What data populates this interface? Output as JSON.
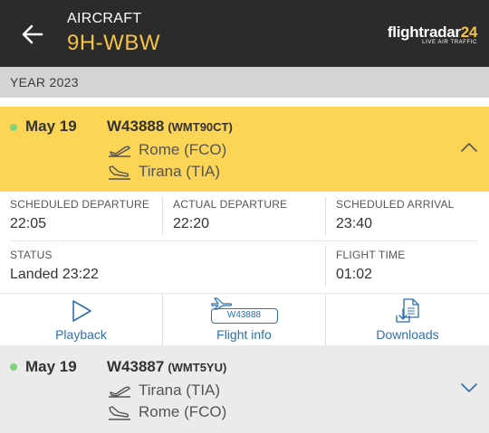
{
  "header": {
    "label": "AIRCRAFT",
    "registration": "9H-WBW",
    "logo_main": "flightradar",
    "logo_num": "24",
    "logo_sub": "LIVE AIR TRAFFIC"
  },
  "year_bar": {
    "label": "YEAR 2023"
  },
  "flights": [
    {
      "date": "May 19",
      "flight_number": "W43888",
      "callsign": "(WMT90CT)",
      "from": "Rome (FCO)",
      "to": "Tirana (TIA)",
      "expanded": true
    },
    {
      "date": "May 19",
      "flight_number": "W43887",
      "callsign": "(WMT5YU)",
      "from": "Tirana (TIA)",
      "to": "Rome (FCO)",
      "expanded": false
    }
  ],
  "details": {
    "scheduled_departure_label": "SCHEDULED DEPARTURE",
    "scheduled_departure": "22:05",
    "actual_departure_label": "ACTUAL DEPARTURE",
    "actual_departure": "22:20",
    "scheduled_arrival_label": "SCHEDULED ARRIVAL",
    "scheduled_arrival": "23:40",
    "status_label": "STATUS",
    "status": "Landed 23:22",
    "flight_time_label": "FLIGHT TIME",
    "flight_time": "01:02"
  },
  "actions": {
    "playback": "Playback",
    "flight_info": "Flight info",
    "flight_info_badge": "W43888",
    "downloads": "Downloads"
  },
  "colors": {
    "header_bg": "#2b2b2b",
    "accent_yellow": "#f6c444",
    "selected_row": "#fcd456",
    "status_dot": "#7fd37b",
    "link_blue": "#2e6fb0"
  }
}
